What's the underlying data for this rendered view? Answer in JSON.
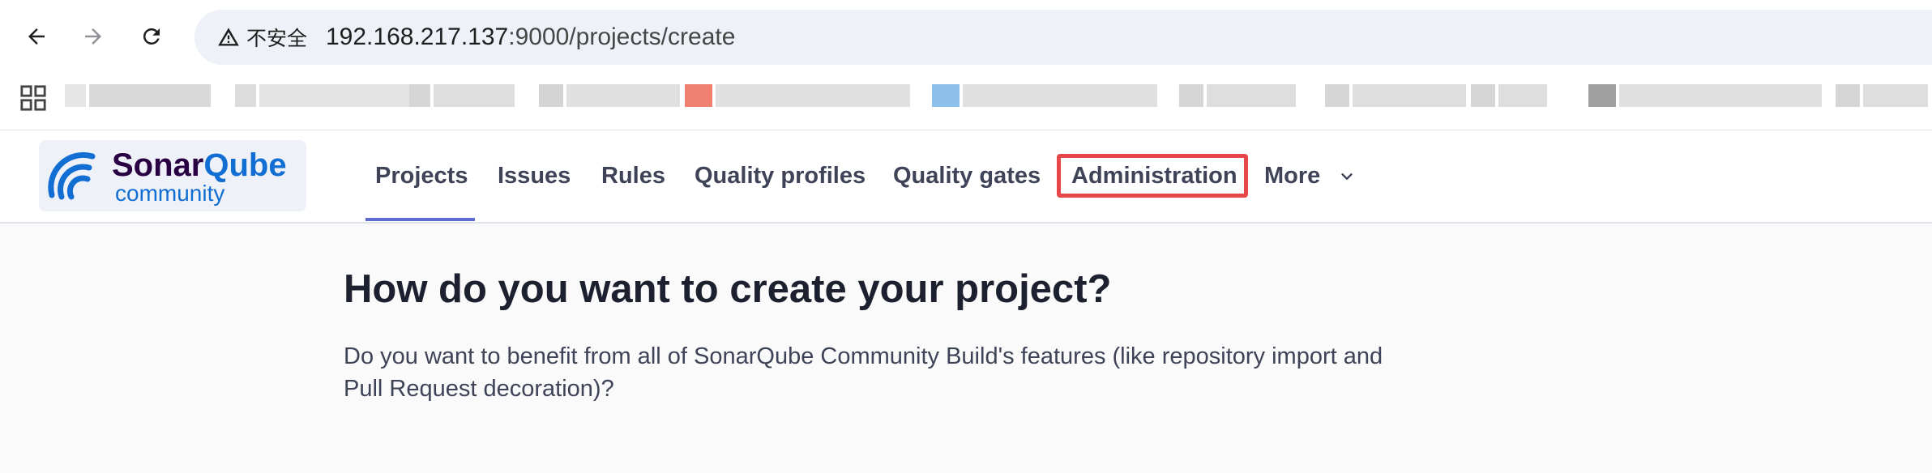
{
  "browser": {
    "security_label": "不安全",
    "url_host": "192.168.217.137",
    "url_path": ":9000/projects/create"
  },
  "app": {
    "logo_primary_1": "Sonar",
    "logo_primary_2": "Qube",
    "logo_secondary": "community",
    "nav": [
      {
        "label": "Projects"
      },
      {
        "label": "Issues"
      },
      {
        "label": "Rules"
      },
      {
        "label": "Quality profiles"
      },
      {
        "label": "Quality gates"
      },
      {
        "label": "Administration"
      },
      {
        "label": "More"
      }
    ],
    "accent_color": "#5d6cd0",
    "highlight_color": "#e8474a"
  },
  "main": {
    "title": "How do you want to create your project?",
    "description": "Do you want to benefit from all of SonarQube Community Build's features (like repository import and Pull Request decoration)?"
  }
}
